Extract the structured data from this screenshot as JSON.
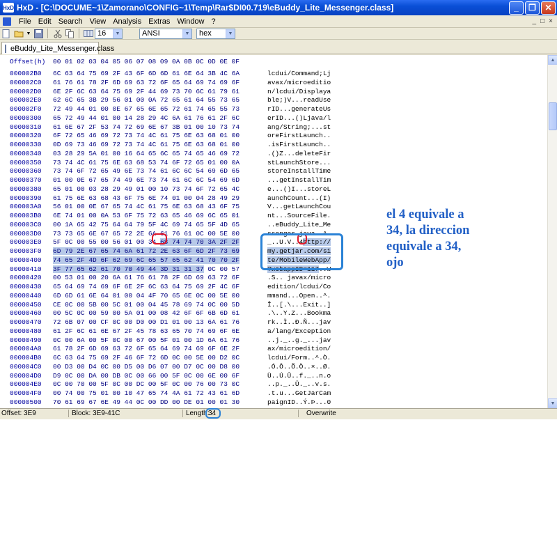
{
  "window": {
    "title": "HxD - [C:\\DOCUME~1\\Zamorano\\CONFIG~1\\Temp\\Rar$DI00.719\\eBuddy_Lite_Messenger.class]",
    "app_icon_text": "HxD"
  },
  "menu": {
    "items": [
      "File",
      "Edit",
      "Search",
      "View",
      "Analysis",
      "Extras",
      "Window",
      "?"
    ],
    "mdi_controls": [
      "_",
      "□",
      "×"
    ]
  },
  "toolbar": {
    "bytes_per_row": "16",
    "charset": "ANSI",
    "display_mode": "hex"
  },
  "tab": {
    "label": "eBuddy_Lite_Messenger.class"
  },
  "editor": {
    "header_label": "Offset(h)",
    "column_headers": [
      "00",
      "01",
      "02",
      "03",
      "04",
      "05",
      "06",
      "07",
      "08",
      "09",
      "0A",
      "0B",
      "0C",
      "0D",
      "0E",
      "0F"
    ],
    "rows": [
      {
        "offset": "000002B0",
        "hex": "6C 63 64 75 69 2F 43 6F 6D 6D 61 6E 64 3B 4C 6A",
        "ascii": "lcdui/Command;Lj"
      },
      {
        "offset": "000002C0",
        "hex": "61 76 61 78 2F 6D 69 63 72 6F 65 64 69 74 69 6F",
        "ascii": "avax/microeditio"
      },
      {
        "offset": "000002D0",
        "hex": "6E 2F 6C 63 64 75 69 2F 44 69 73 70 6C 61 79 61",
        "ascii": "n/lcdui/Displaya"
      },
      {
        "offset": "000002E0",
        "hex": "62 6C 65 3B 29 56 01 00 0A 72 65 61 64 55 73 65",
        "ascii": "ble;)V...readUse"
      },
      {
        "offset": "000002F0",
        "hex": "72 49 44 01 00 0E 67 65 6E 65 72 61 74 65 55 73",
        "ascii": "rID...generateUs"
      },
      {
        "offset": "00000300",
        "hex": "65 72 49 44 01 00 14 28 29 4C 6A 61 76 61 2F 6C",
        "ascii": "erID...()Ljava/l"
      },
      {
        "offset": "00000310",
        "hex": "61 6E 67 2F 53 74 72 69 6E 67 3B 01 00 10 73 74",
        "ascii": "ang/String;...st"
      },
      {
        "offset": "00000320",
        "hex": "6F 72 65 46 69 72 73 74 4C 61 75 6E 63 68 01 00",
        "ascii": "oreFirstLaunch.."
      },
      {
        "offset": "00000330",
        "hex": "0D 69 73 46 69 72 73 74 4C 61 75 6E 63 68 01 00",
        "ascii": ".isFirstLaunch.."
      },
      {
        "offset": "00000340",
        "hex": "03 28 29 5A 01 00 16 64 65 6C 65 74 65 46 69 72",
        "ascii": ".()Z...deleteFir"
      },
      {
        "offset": "00000350",
        "hex": "73 74 4C 61 75 6E 63 68 53 74 6F 72 65 01 00 0A",
        "ascii": "stLaunchStore..."
      },
      {
        "offset": "00000360",
        "hex": "73 74 6F 72 65 49 6E 73 74 61 6C 6C 54 69 6D 65",
        "ascii": "storeInstallTime"
      },
      {
        "offset": "00000370",
        "hex": "01 00 0E 67 65 74 49 6E 73 74 61 6C 6C 54 69 6D",
        "ascii": "...getInstallTim"
      },
      {
        "offset": "00000380",
        "hex": "65 01 00 03 28 29 49 01 00 10 73 74 6F 72 65 4C",
        "ascii": "e...()I...storeL"
      },
      {
        "offset": "00000390",
        "hex": "61 75 6E 63 68 43 6F 75 6E 74 01 00 04 28 49 29",
        "ascii": "aunchCount...(I)"
      },
      {
        "offset": "000003A0",
        "hex": "56 01 00 0E 67 65 74 4C 61 75 6E 63 68 43 6F 75",
        "ascii": "V...getLaunchCou"
      },
      {
        "offset": "000003B0",
        "hex": "6E 74 01 00 0A 53 6F 75 72 63 65 46 69 6C 65 01",
        "ascii": "nt...SourceFile."
      },
      {
        "offset": "000003C0",
        "hex": "00 1A 65 42 75 64 64 79 5F 4C 69 74 65 5F 4D 65",
        "ascii": "..eBuddy_Lite_Me"
      },
      {
        "offset": "000003D0",
        "hex": "73 73 65 6E 67 65 72 2E 6A 61 76 61 0C 00 5E 00",
        "ascii": "ssenger.java..^."
      },
      {
        "offset": "000003E0",
        "hex": "5F 0C 00 55 00 56 01 00 34 68 74 74 70 3A 2F 2F",
        "ascii": "_..U.V..4http://"
      },
      {
        "offset": "000003F0",
        "hex": "6D 79 2E 67 65 74 6A 61 72 2E 63 6F 6D 2F 73 69",
        "ascii": "my.getjar.com/si"
      },
      {
        "offset": "00000400",
        "hex": "74 65 2F 4D 6F 62 69 6C 65 57 65 62 41 70 70 2F",
        "ascii": "te/MobileWebApp/"
      },
      {
        "offset": "00000410",
        "hex": "3F 77 65 62 61 70 70 49 44 3D 31 31 37 0C 00 57",
        "ascii": "?webappID=117..W"
      },
      {
        "offset": "00000420",
        "hex": "00 53 01 00 20 6A 61 76 61 78 2F 6D 69 63 72 6F",
        "ascii": ".S.. javax/micro"
      },
      {
        "offset": "00000430",
        "hex": "65 64 69 74 69 6F 6E 2F 6C 63 64 75 69 2F 4C 6F",
        "ascii": "edition/lcdui/Co"
      },
      {
        "offset": "00000440",
        "hex": "6D 6D 61 6E 64 01 00 04 4F 70 65 6E 0C 00 5E 00",
        "ascii": "mmand...Open..^."
      },
      {
        "offset": "00000450",
        "hex": "CE 0C 00 5B 00 5C 01 00 04 45 78 69 74 0C 00 5D",
        "ascii": "Î..[.\\...Exit..]"
      },
      {
        "offset": "00000460",
        "hex": "00 5C 0C 00 59 00 5A 01 00 08 42 6F 6F 6B 6D 61",
        "ascii": ".\\..Y.Z...Bookma"
      },
      {
        "offset": "00000470",
        "hex": "72 6B 07 00 CF 0C 00 D0 00 D1 01 00 13 6A 61 76",
        "ascii": "rk..Ï..Ð.Ñ...jav"
      },
      {
        "offset": "00000480",
        "hex": "61 2F 6C 61 6E 67 2F 45 78 63 65 70 74 69 6F 6E",
        "ascii": "a/lang/Exception"
      },
      {
        "offset": "00000490",
        "hex": "0C 00 6A 00 5F 0C 00 67 00 5F 01 00 1D 6A 61 76",
        "ascii": "..j._..g._...jav"
      },
      {
        "offset": "000004A0",
        "hex": "61 78 2F 6D 69 63 72 6F 65 64 69 74 69 6F 6E 2F",
        "ascii": "ax/microedition/"
      },
      {
        "offset": "000004B0",
        "hex": "6C 63 64 75 69 2F 46 6F 72 6D 0C 00 5E 00 D2 0C",
        "ascii": "lcdui/Form..^.Ò."
      },
      {
        "offset": "000004C0",
        "hex": "00 D3 00 D4 0C 00 D5 00 D6 07 00 D7 0C 00 D8 00",
        "ascii": ".Ó.Ô..Õ.Ö..×..Ø."
      },
      {
        "offset": "000004D0",
        "hex": "D9 0C 00 DA 00 DB 0C 00 66 00 5F 0C 00 6E 00 6F",
        "ascii": "Ù..Ú.Û..f._..n.o"
      },
      {
        "offset": "000004E0",
        "hex": "0C 00 70 00 5F 0C 00 DC 00 5F 0C 00 76 00 73 0C",
        "ascii": "..p._..Ü._..v.s."
      },
      {
        "offset": "000004F0",
        "hex": "00 74 00 75 01 00 10 47 65 74 4A 61 72 43 61 6D",
        "ascii": ".t.u...GetJarCam"
      },
      {
        "offset": "00000500",
        "hex": "70 61 69 67 6E 49 44 0C 00 DD 00 DE 01 00 01 30",
        "ascii": "paignID..Ý.Þ...0"
      },
      {
        "offset": "00000510",
        "hex": "01 00 16 6A 61 76 61 2F 6C 61 6E 67 2F 53 74 72",
        "ascii": "...java/lang/Str"
      }
    ]
  },
  "annotation": {
    "lines": [
      "el 4 equivale a",
      "34, la direccion",
      "equivale a 34,",
      "ojo"
    ],
    "color": "#2260c6"
  },
  "status": {
    "offset": "Offset: 3E9",
    "block": "Block: 3E9-41C",
    "length_label": "Length:",
    "length_value": "34",
    "mode": "Overwrite"
  }
}
